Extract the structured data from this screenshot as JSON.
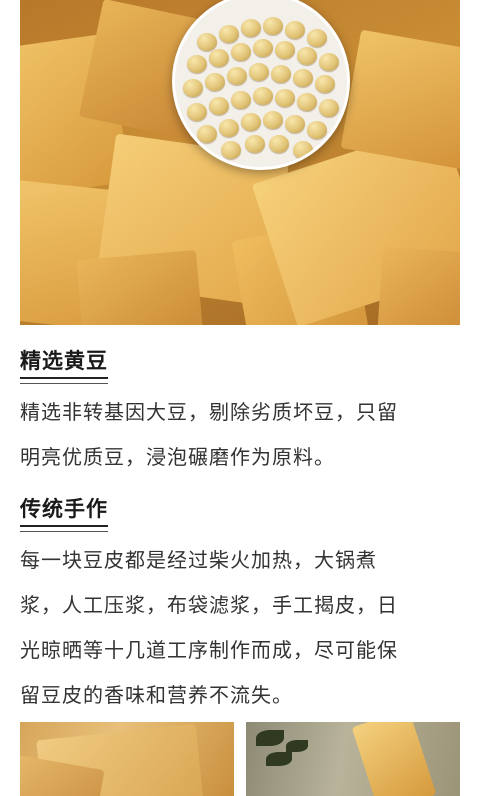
{
  "hero_image": {
    "subject": "dried tofu skin sheets with a plate of soybeans"
  },
  "sections": [
    {
      "title": "精选黄豆",
      "lines": [
        "精选非转基因大豆，剔除劣质坏豆，只留",
        "明亮优质豆，浸泡碾磨作为原料。"
      ]
    },
    {
      "title": "传统手作",
      "lines": [
        "每一块豆皮都是经过柴火加热，大锅煮",
        "浆，人工压浆，布袋滤浆，手工揭皮，日",
        "光晾晒等十几道工序制作而成，尽可能保",
        "留豆皮的香味和营养不流失。"
      ]
    }
  ],
  "thumbnails": {
    "left": "tofu skin close-up",
    "right": "tofu skin drying outdoors"
  }
}
